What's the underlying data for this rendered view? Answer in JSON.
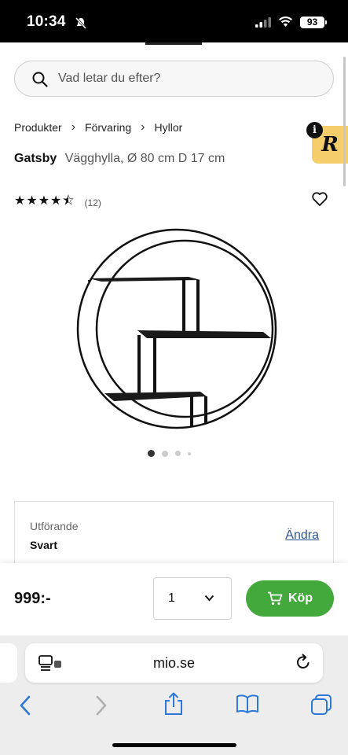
{
  "status": {
    "time": "10:34",
    "battery": "93"
  },
  "search": {
    "placeholder": "Vad letar du efter?"
  },
  "breadcrumb": [
    "Produkter",
    "Förvaring",
    "Hyllor"
  ],
  "badge": {
    "letter": "R",
    "info": "i"
  },
  "product": {
    "brand": "Gatsby",
    "description": "Vägghylla, Ø 80 cm D 17 cm",
    "rating": 4.5,
    "stars": "★★★★⯪",
    "review_count": "(12)"
  },
  "gallery": {
    "total": 4,
    "active": 0
  },
  "variant": {
    "label": "Utförande",
    "value": "Svart",
    "change": "Ändra"
  },
  "buy": {
    "price": "999:-",
    "quantity": "1",
    "button": "Köp",
    "button_color": "#43a93c"
  },
  "browser": {
    "url": "mio.se"
  }
}
